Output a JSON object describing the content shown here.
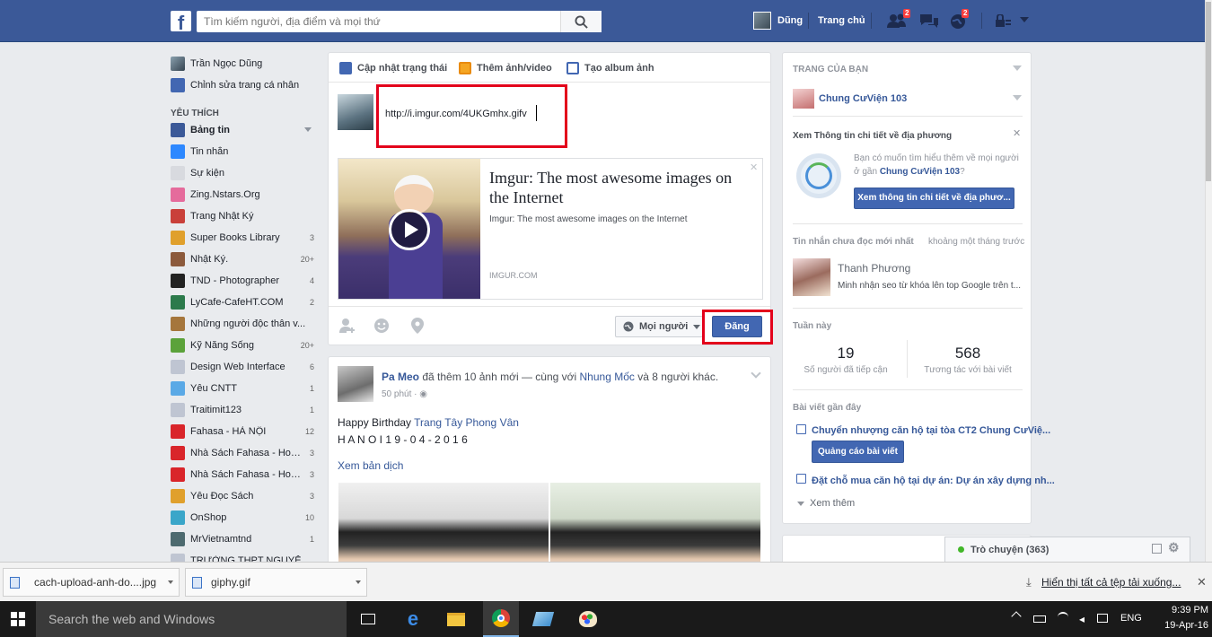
{
  "header": {
    "search_placeholder": "Tìm kiếm người, địa điểm và mọi thứ",
    "profile_name": "Dũng",
    "home_label": "Trang chủ",
    "friend_requests_badge": "2",
    "notifications_badge": "2"
  },
  "left_nav": {
    "profile_name": "Trần Ngọc Dũng",
    "edit_profile": "Chỉnh sửa trang cá nhân",
    "favorites_heading": "YÊU THÍCH",
    "items": [
      {
        "label": "Bảng tin",
        "count": "",
        "bold": true,
        "color": "#3b5998"
      },
      {
        "label": "Tin nhắn",
        "count": "",
        "color": "#2d88ff"
      },
      {
        "label": "Sự kiện",
        "count": "",
        "color": "#d8dadf"
      },
      {
        "label": "Zing.Nstars.Org",
        "count": "",
        "color": "#e56b9c"
      },
      {
        "label": "Trang Nhật Ký",
        "count": "",
        "color": "#c9403a"
      },
      {
        "label": "Super Books Library",
        "count": "3",
        "color": "#e0a02c"
      },
      {
        "label": "Nhật Ký.",
        "count": "20+",
        "color": "#8c5a3c"
      },
      {
        "label": "TND - Photographer",
        "count": "4",
        "color": "#222222"
      },
      {
        "label": "LyCafe-CafeHT.COM",
        "count": "2",
        "color": "#2c7a4b"
      },
      {
        "label": "Những người độc thân v...",
        "count": "",
        "color": "#a5763c"
      },
      {
        "label": "Kỹ Năng Sống",
        "count": "20+",
        "color": "#5ba23a"
      },
      {
        "label": "Design Web Interface",
        "count": "6",
        "color": "#bfc5d2"
      },
      {
        "label": "Yêu CNTT",
        "count": "1",
        "color": "#5aa9e6"
      },
      {
        "label": "Traitimit123",
        "count": "1",
        "color": "#bfc5d2"
      },
      {
        "label": "Fahasa - HÀ NỘI",
        "count": "12",
        "color": "#d9252a"
      },
      {
        "label": "Nhà Sách Fahasa - Hoàn...",
        "count": "3",
        "color": "#d9252a"
      },
      {
        "label": "Nhà Sách Fahasa - Hoàn...",
        "count": "3",
        "color": "#d9252a"
      },
      {
        "label": "Yêu Đọc Sách",
        "count": "3",
        "color": "#e0a02c"
      },
      {
        "label": "OnShop",
        "count": "10",
        "color": "#3aa6c9"
      },
      {
        "label": "MrVietnamtnd",
        "count": "1",
        "color": "#4d6a6f"
      },
      {
        "label": "TRƯỜNG THPT NGUYỄ...",
        "count": "",
        "color": "#bfc5d2"
      }
    ]
  },
  "composer": {
    "tab_status": "Cập nhật trạng thái",
    "tab_photo": "Thêm ảnh/video",
    "tab_album": "Tạo album ảnh",
    "input_value": "http://i.imgur.com/4UKGmhx.gifv",
    "preview_title": "Imgur: The most awesome images on the Internet",
    "preview_desc": "Imgur: The most awesome images on the Internet",
    "preview_domain": "IMGUR.COM",
    "audience": "Mọi người",
    "post_button": "Đăng"
  },
  "feed_post": {
    "author": "Pa Meo",
    "action": " đã thêm 10 ảnh mới — cùng với ",
    "tagged": "Nhung Mốc",
    "and_others": " và 8 người khác.",
    "time": "50 phút · ",
    "text_prefix": "Happy Birthday ",
    "text_link": "Trang Tây Phong Vân",
    "text_line2": "H A N O I 1 9 - 0 4 - 2 0 1 6",
    "translate": "Xem bản dịch"
  },
  "right": {
    "pages_heading": "TRANG CỦA BẠN",
    "page_name": "Chung CưViện 103",
    "local_info_heading": "Xem Thông tin chi tiết về địa phương",
    "local_info_text1": "Bạn có muốn tìm hiểu thêm về mọi người ở gần ",
    "local_info_page": "Chung CưViện 103",
    "local_info_text2": "?",
    "local_info_button": "Xem thông tin chi tiết về địa phươ...",
    "unread_heading": "Tin nhắn chưa đọc mới nhất",
    "unread_time": "khoảng một tháng trước",
    "unread_name": "Thanh Phương",
    "unread_snippet": "Minh nhận seo từ khóa lên top Google trên t...",
    "week_heading": "Tuần này",
    "stat1_value": "19",
    "stat1_label": "Số người đã tiếp cận",
    "stat2_value": "568",
    "stat2_label": "Tương tác với bài viết",
    "recent_heading": "Bài viết gần đây",
    "recent1": "Chuyển nhượng căn hộ tại tòa CT2 Chung CưViệ...",
    "boost_button": "Quảng cáo bài viết",
    "recent2": "Đặt chỗ mua căn hộ tại dự án: Dự án xây dựng nh...",
    "see_more": "Xem thêm"
  },
  "chat": {
    "label": "Trò chuyện (363)"
  },
  "downloads": {
    "item1": "cach-upload-anh-do....jpg",
    "item2": "giphy.gif",
    "show_all": "Hiển thị tất cả tệp tải xuống..."
  },
  "taskbar": {
    "search": "Search the web and Windows",
    "lang": "ENG",
    "time": "9:39 PM",
    "date": "19-Apr-16"
  }
}
